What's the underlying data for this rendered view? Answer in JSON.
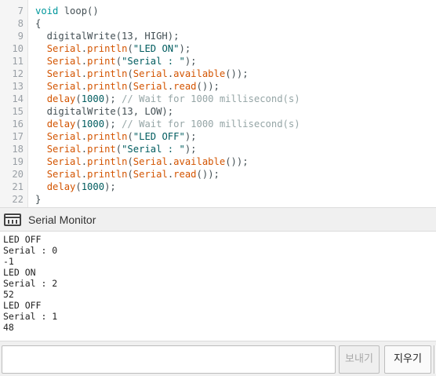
{
  "editor": {
    "lines": [
      {
        "n": "7",
        "tokens": [
          {
            "t": "kw",
            "v": "void"
          },
          {
            "t": "plain",
            "v": " loop()"
          }
        ]
      },
      {
        "n": "8",
        "tokens": [
          {
            "t": "plain",
            "v": "{"
          }
        ]
      },
      {
        "n": "9",
        "tokens": [
          {
            "t": "plain",
            "v": "  digitalWrite(13, HIGH);"
          }
        ]
      },
      {
        "n": "10",
        "tokens": [
          {
            "t": "plain",
            "v": "  "
          },
          {
            "t": "fn",
            "v": "Serial"
          },
          {
            "t": "plain",
            "v": "."
          },
          {
            "t": "fn",
            "v": "println"
          },
          {
            "t": "plain",
            "v": "("
          },
          {
            "t": "str",
            "v": "\"LED ON\""
          },
          {
            "t": "plain",
            "v": ");"
          }
        ]
      },
      {
        "n": "11",
        "tokens": [
          {
            "t": "plain",
            "v": "  "
          },
          {
            "t": "fn",
            "v": "Serial"
          },
          {
            "t": "plain",
            "v": "."
          },
          {
            "t": "fn",
            "v": "print"
          },
          {
            "t": "plain",
            "v": "("
          },
          {
            "t": "str",
            "v": "\"Serial : \""
          },
          {
            "t": "plain",
            "v": ");"
          }
        ]
      },
      {
        "n": "12",
        "tokens": [
          {
            "t": "plain",
            "v": "  "
          },
          {
            "t": "fn",
            "v": "Serial"
          },
          {
            "t": "plain",
            "v": "."
          },
          {
            "t": "fn",
            "v": "println"
          },
          {
            "t": "plain",
            "v": "("
          },
          {
            "t": "fn",
            "v": "Serial"
          },
          {
            "t": "plain",
            "v": "."
          },
          {
            "t": "fn",
            "v": "available"
          },
          {
            "t": "plain",
            "v": "());"
          }
        ]
      },
      {
        "n": "13",
        "tokens": [
          {
            "t": "plain",
            "v": "  "
          },
          {
            "t": "fn",
            "v": "Serial"
          },
          {
            "t": "plain",
            "v": "."
          },
          {
            "t": "fn",
            "v": "println"
          },
          {
            "t": "plain",
            "v": "("
          },
          {
            "t": "fn",
            "v": "Serial"
          },
          {
            "t": "plain",
            "v": "."
          },
          {
            "t": "fn",
            "v": "read"
          },
          {
            "t": "plain",
            "v": "());"
          }
        ]
      },
      {
        "n": "14",
        "tokens": [
          {
            "t": "plain",
            "v": "  "
          },
          {
            "t": "fn",
            "v": "delay"
          },
          {
            "t": "plain",
            "v": "("
          },
          {
            "t": "num",
            "v": "1000"
          },
          {
            "t": "plain",
            "v": "); "
          },
          {
            "t": "cm",
            "v": "// Wait for 1000 millisecond(s)"
          }
        ]
      },
      {
        "n": "15",
        "tokens": [
          {
            "t": "plain",
            "v": "  digitalWrite(13, LOW);"
          }
        ]
      },
      {
        "n": "16",
        "tokens": [
          {
            "t": "plain",
            "v": "  "
          },
          {
            "t": "fn",
            "v": "delay"
          },
          {
            "t": "plain",
            "v": "("
          },
          {
            "t": "num",
            "v": "1000"
          },
          {
            "t": "plain",
            "v": "); "
          },
          {
            "t": "cm",
            "v": "// Wait for 1000 millisecond(s)"
          }
        ]
      },
      {
        "n": "17",
        "tokens": [
          {
            "t": "plain",
            "v": "  "
          },
          {
            "t": "fn",
            "v": "Serial"
          },
          {
            "t": "plain",
            "v": "."
          },
          {
            "t": "fn",
            "v": "println"
          },
          {
            "t": "plain",
            "v": "("
          },
          {
            "t": "str",
            "v": "\"LED OFF\""
          },
          {
            "t": "plain",
            "v": ");"
          }
        ]
      },
      {
        "n": "18",
        "tokens": [
          {
            "t": "plain",
            "v": "  "
          },
          {
            "t": "fn",
            "v": "Serial"
          },
          {
            "t": "plain",
            "v": "."
          },
          {
            "t": "fn",
            "v": "print"
          },
          {
            "t": "plain",
            "v": "("
          },
          {
            "t": "str",
            "v": "\"Serial : \""
          },
          {
            "t": "plain",
            "v": ");"
          }
        ]
      },
      {
        "n": "19",
        "tokens": [
          {
            "t": "plain",
            "v": "  "
          },
          {
            "t": "fn",
            "v": "Serial"
          },
          {
            "t": "plain",
            "v": "."
          },
          {
            "t": "fn",
            "v": "println"
          },
          {
            "t": "plain",
            "v": "("
          },
          {
            "t": "fn",
            "v": "Serial"
          },
          {
            "t": "plain",
            "v": "."
          },
          {
            "t": "fn",
            "v": "available"
          },
          {
            "t": "plain",
            "v": "());"
          }
        ]
      },
      {
        "n": "20",
        "tokens": [
          {
            "t": "plain",
            "v": "  "
          },
          {
            "t": "fn",
            "v": "Serial"
          },
          {
            "t": "plain",
            "v": "."
          },
          {
            "t": "fn",
            "v": "println"
          },
          {
            "t": "plain",
            "v": "("
          },
          {
            "t": "fn",
            "v": "Serial"
          },
          {
            "t": "plain",
            "v": "."
          },
          {
            "t": "fn",
            "v": "read"
          },
          {
            "t": "plain",
            "v": "());"
          }
        ]
      },
      {
        "n": "21",
        "tokens": [
          {
            "t": "plain",
            "v": "  "
          },
          {
            "t": "fn",
            "v": "delay"
          },
          {
            "t": "plain",
            "v": "("
          },
          {
            "t": "num",
            "v": "1000"
          },
          {
            "t": "plain",
            "v": ");"
          }
        ]
      },
      {
        "n": "22",
        "tokens": [
          {
            "t": "plain",
            "v": "}"
          }
        ]
      }
    ]
  },
  "serial_monitor": {
    "title": "Serial Monitor",
    "icon": "serial-monitor-icon",
    "output": [
      "LED OFF",
      "Serial : 0",
      "-1",
      "LED ON",
      "Serial : 2",
      "52",
      "LED OFF",
      "Serial : 1",
      "48"
    ],
    "input_value": "",
    "send_label": "보내기",
    "clear_label": "지우기"
  },
  "colors": {
    "keyword": "#00979c",
    "function": "#d35400",
    "string": "#005c5f",
    "comment": "#95a5a6",
    "line_number": "#9aa0a6"
  }
}
